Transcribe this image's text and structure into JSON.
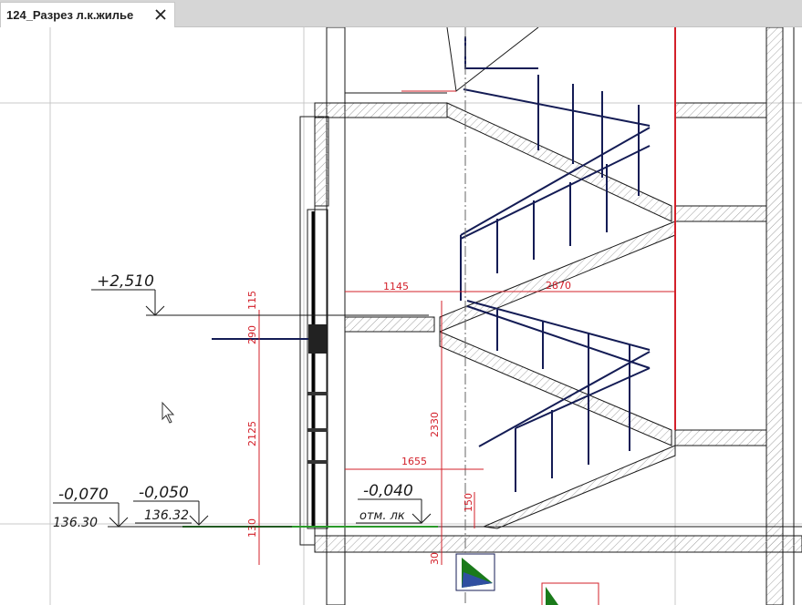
{
  "tab": {
    "title": "124_Разрез л.к.жилье",
    "close_icon": "close-icon"
  },
  "colors": {
    "dimension": "#d3202a",
    "railing": "#141c55",
    "line": "#1a1a1a",
    "guide": "#c8c8c8",
    "green": "#2a9a2a",
    "hatch": "#9a9a9a"
  },
  "levels": [
    {
      "mark": "+2,510",
      "sub": ""
    },
    {
      "mark": "-0,070",
      "sub": "136.30"
    },
    {
      "mark": "-0,050",
      "sub": "136.32"
    },
    {
      "mark": "-0,040",
      "sub": "отм. лк"
    }
  ],
  "dimensions": [
    "1145",
    "2870",
    "115",
    "290",
    "2125",
    "2330",
    "1655",
    "150",
    "30",
    "130"
  ]
}
